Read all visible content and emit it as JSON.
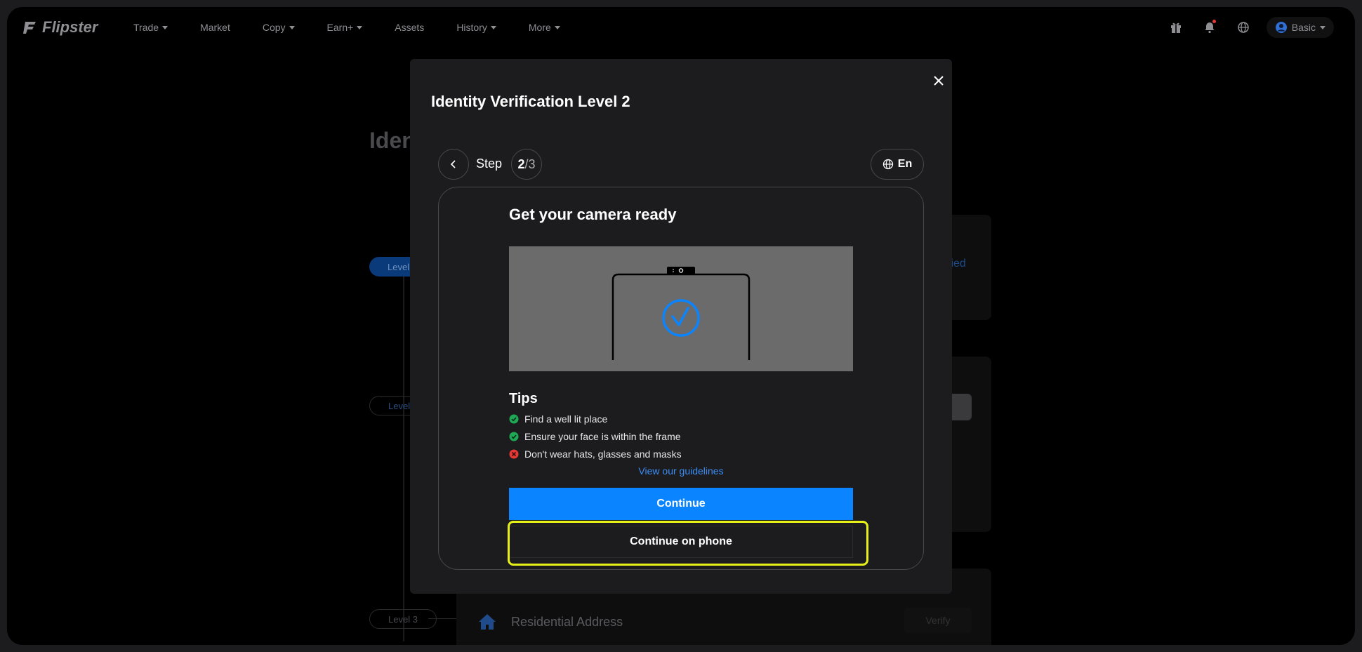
{
  "nav": {
    "logo": "Flipster",
    "items": [
      {
        "label": "Trade",
        "has_caret": true
      },
      {
        "label": "Market",
        "has_caret": false
      },
      {
        "label": "Copy",
        "has_caret": true
      },
      {
        "label": "Earn+",
        "has_caret": true
      },
      {
        "label": "Assets",
        "has_caret": false
      },
      {
        "label": "History",
        "has_caret": true
      },
      {
        "label": "More",
        "has_caret": true
      }
    ],
    "user_tier": "Basic"
  },
  "background": {
    "title_fragment": "Iden",
    "level_1": "Level",
    "level_2": "Level",
    "level_3": "Level 3",
    "verified_fragment": "fied",
    "residential_address": "Residential Address",
    "verify_button": "Verify"
  },
  "modal": {
    "title": "Identity Verification Level 2",
    "step_label": "Step",
    "step_current": "2",
    "step_separator": "/",
    "step_total": "3",
    "language": "En",
    "card": {
      "heading": "Get your camera ready",
      "tips_title": "Tips",
      "tips": [
        {
          "text": "Find a well lit place",
          "status": "ok"
        },
        {
          "text": "Ensure your face is within the frame",
          "status": "ok"
        },
        {
          "text": "Don't wear hats, glasses and masks",
          "status": "bad"
        }
      ],
      "guidelines_link": "View our guidelines",
      "continue_label": "Continue",
      "continue_on_phone_label": "Continue on phone"
    }
  },
  "colors": {
    "accent": "#0a84ff",
    "ok": "#1fa855",
    "bad": "#e53935",
    "highlight": "#e8f01a"
  }
}
